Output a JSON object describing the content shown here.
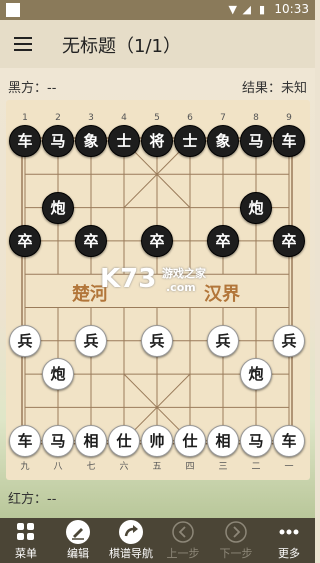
{
  "status_bar": {
    "time": "10:33"
  },
  "app_bar": {
    "title": "无标题（1/1）"
  },
  "players": {
    "black_label": "黑方：--",
    "red_label": "红方：--",
    "result_label": "结果：未知"
  },
  "board": {
    "top_coords": [
      "1",
      "2",
      "3",
      "4",
      "5",
      "6",
      "7",
      "8",
      "9"
    ],
    "bottom_coords": [
      "九",
      "八",
      "七",
      "六",
      "五",
      "四",
      "三",
      "二",
      "一"
    ],
    "river_left": "楚河",
    "river_right": "汉界",
    "pieces": [
      {
        "side": "black",
        "label": "车",
        "col": 0,
        "row": 0
      },
      {
        "side": "black",
        "label": "马",
        "col": 1,
        "row": 0
      },
      {
        "side": "black",
        "label": "象",
        "col": 2,
        "row": 0
      },
      {
        "side": "black",
        "label": "士",
        "col": 3,
        "row": 0
      },
      {
        "side": "black",
        "label": "将",
        "col": 4,
        "row": 0
      },
      {
        "side": "black",
        "label": "士",
        "col": 5,
        "row": 0
      },
      {
        "side": "black",
        "label": "象",
        "col": 6,
        "row": 0
      },
      {
        "side": "black",
        "label": "马",
        "col": 7,
        "row": 0
      },
      {
        "side": "black",
        "label": "车",
        "col": 8,
        "row": 0
      },
      {
        "side": "black",
        "label": "炮",
        "col": 1,
        "row": 2
      },
      {
        "side": "black",
        "label": "炮",
        "col": 7,
        "row": 2
      },
      {
        "side": "black",
        "label": "卒",
        "col": 0,
        "row": 3
      },
      {
        "side": "black",
        "label": "卒",
        "col": 2,
        "row": 3
      },
      {
        "side": "black",
        "label": "卒",
        "col": 4,
        "row": 3
      },
      {
        "side": "black",
        "label": "卒",
        "col": 6,
        "row": 3
      },
      {
        "side": "black",
        "label": "卒",
        "col": 8,
        "row": 3
      },
      {
        "side": "red",
        "label": "兵",
        "col": 0,
        "row": 6
      },
      {
        "side": "red",
        "label": "兵",
        "col": 2,
        "row": 6
      },
      {
        "side": "red",
        "label": "兵",
        "col": 4,
        "row": 6
      },
      {
        "side": "red",
        "label": "兵",
        "col": 6,
        "row": 6
      },
      {
        "side": "red",
        "label": "兵",
        "col": 8,
        "row": 6
      },
      {
        "side": "red",
        "label": "炮",
        "col": 1,
        "row": 7
      },
      {
        "side": "red",
        "label": "炮",
        "col": 7,
        "row": 7
      },
      {
        "side": "red",
        "label": "车",
        "col": 0,
        "row": 9
      },
      {
        "side": "red",
        "label": "马",
        "col": 1,
        "row": 9
      },
      {
        "side": "red",
        "label": "相",
        "col": 2,
        "row": 9
      },
      {
        "side": "red",
        "label": "仕",
        "col": 3,
        "row": 9
      },
      {
        "side": "red",
        "label": "帅",
        "col": 4,
        "row": 9
      },
      {
        "side": "red",
        "label": "仕",
        "col": 5,
        "row": 9
      },
      {
        "side": "red",
        "label": "相",
        "col": 6,
        "row": 9
      },
      {
        "side": "red",
        "label": "马",
        "col": 7,
        "row": 9
      },
      {
        "side": "red",
        "label": "车",
        "col": 8,
        "row": 9
      }
    ]
  },
  "watermark": {
    "logo": "K73",
    "text1": "游戏之家",
    "text2": ".com"
  },
  "bottom_bar": {
    "items": [
      {
        "label": "菜单",
        "icon": "grid-icon",
        "enabled": true
      },
      {
        "label": "编辑",
        "icon": "edit-icon",
        "enabled": true
      },
      {
        "label": "棋谱导航",
        "icon": "redo-icon",
        "enabled": true
      },
      {
        "label": "上一步",
        "icon": "chevron-left-icon",
        "enabled": false
      },
      {
        "label": "下一步",
        "icon": "chevron-right-icon",
        "enabled": false
      },
      {
        "label": "更多",
        "icon": "more-icon",
        "enabled": true
      }
    ]
  },
  "colors": {
    "black_piece": "#1d1d1d",
    "red_piece_bg": "#ffffff",
    "board_line": "#9a7b5a",
    "river_text": "#b2763a"
  }
}
